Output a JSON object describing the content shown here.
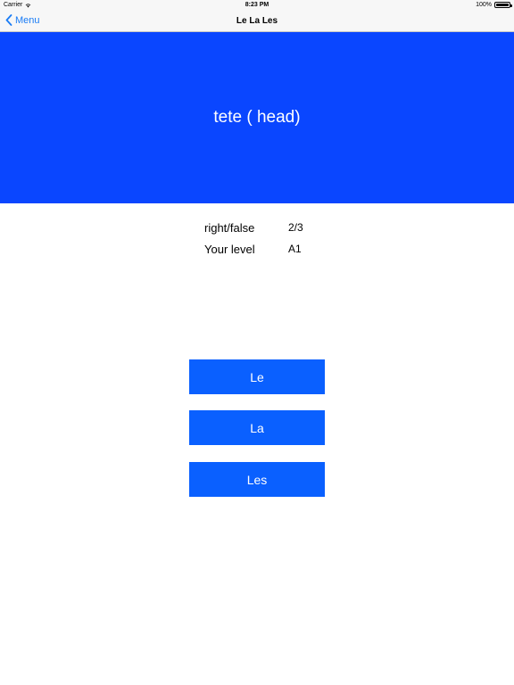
{
  "statusbar": {
    "carrier": "Carrier",
    "time": "8:23 PM",
    "battery": "100%",
    "battery_level": 1.0
  },
  "navbar": {
    "back_label": "Menu",
    "title": "Le La Les"
  },
  "word": {
    "text": "tete ( head)",
    "panel_color": "#0a46ff"
  },
  "stats": {
    "score_label": "right/false",
    "score_value": "2/3",
    "level_label": "Your level",
    "level_value": "A1"
  },
  "answers": [
    {
      "label": "Le"
    },
    {
      "label": "La"
    },
    {
      "label": "Les"
    }
  ],
  "colors": {
    "accent": "#1a7cf5",
    "button": "#0a60ff"
  }
}
